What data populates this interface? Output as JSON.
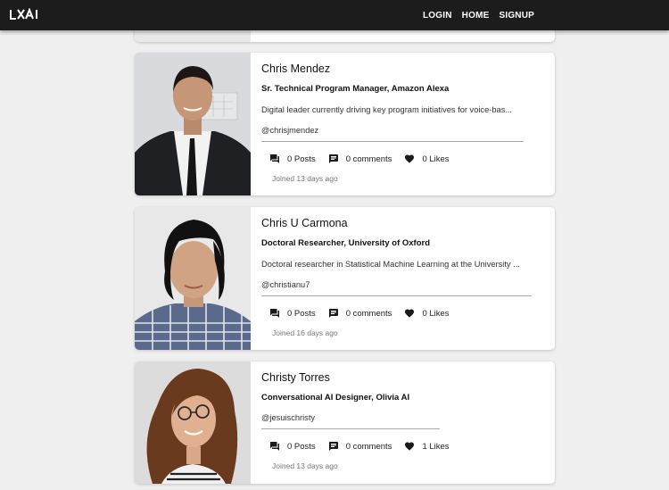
{
  "nav": {
    "logo": "LXAI",
    "links": [
      "LOGIN",
      "HOME",
      "SIGNUP"
    ]
  },
  "profiles": [
    {
      "name": "Chris Mendez",
      "title": "Sr. Technical Program Manager, Amazon Alexa",
      "bio": "Digital leader currently driving key program initiatives for voice-bas...",
      "handle": "@chrisjmendez",
      "posts": "0 Posts",
      "comments": "0 comments",
      "likes": "0 Likes",
      "joined": "Joined 13 days ago"
    },
    {
      "name": "Chris U Carmona",
      "title": "Doctoral Researcher, University of Oxford",
      "bio": "Doctoral researcher in Statistical Machine Learning at the University ...",
      "handle": "@christianu7",
      "posts": "0 Posts",
      "comments": "0 comments",
      "likes": "0 Likes",
      "joined": "Joined 16 days ago"
    },
    {
      "name": "Christy Torres",
      "title": "Conversational AI Designer, Olivia AI",
      "bio": "",
      "handle": "@jesuischristy",
      "posts": "0 Posts",
      "comments": "0 comments",
      "likes": "1 Likes",
      "joined": "Joined 13 days ago"
    }
  ],
  "colors": {
    "navbar": "#1c1c1c",
    "background": "#efefef",
    "card": "#ffffff",
    "icon": "#1a1a1a"
  },
  "icons": [
    "posts-icon",
    "comments-icon",
    "heart-icon"
  ]
}
